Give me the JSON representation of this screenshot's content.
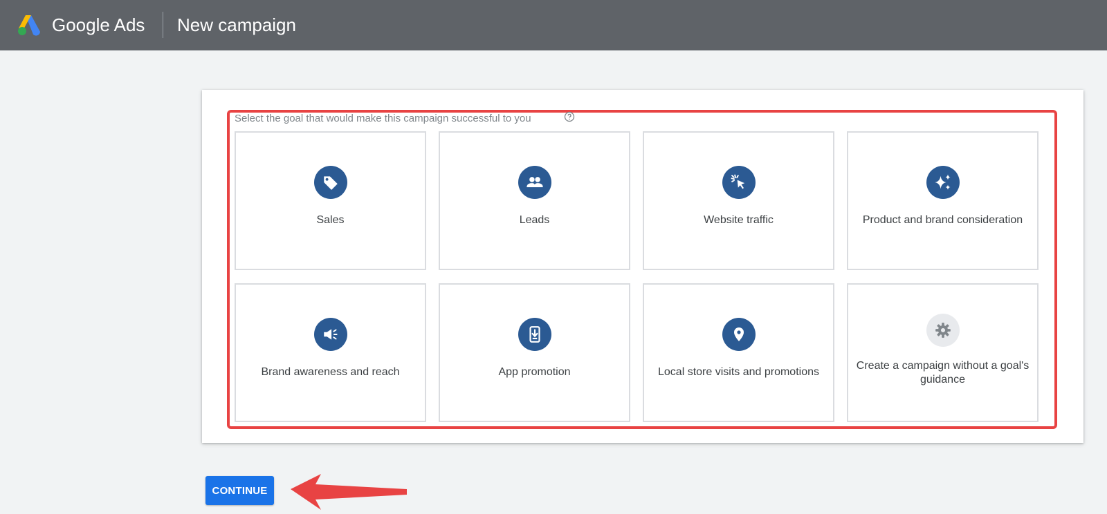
{
  "header": {
    "brand": "Google Ads",
    "page_title": "New campaign",
    "logo_icon": "google-ads-logo",
    "background_color": "#5f6368"
  },
  "goal_selection": {
    "prompt": "Select the goal that would make this campaign successful to you",
    "help_icon": "help-circle-icon",
    "goals": [
      {
        "label": "Sales",
        "icon": "tag-icon"
      },
      {
        "label": "Leads",
        "icon": "people-icon"
      },
      {
        "label": "Website traffic",
        "icon": "cursor-click-icon"
      },
      {
        "label": "Product and brand consideration",
        "icon": "sparkle-icon"
      },
      {
        "label": "Brand awareness and reach",
        "icon": "megaphone-icon"
      },
      {
        "label": "App promotion",
        "icon": "phone-download-icon"
      },
      {
        "label": "Local store visits and promotions",
        "icon": "map-pin-icon"
      },
      {
        "label": "Create a campaign without a goal's guidance",
        "icon": "gear-icon"
      }
    ],
    "icon_color": "#2b5a93",
    "highlight_color": "#e84343"
  },
  "actions": {
    "continue_label": "CONTINUE",
    "continue_color": "#1a73e8",
    "annotation_arrow_color": "#e84343"
  }
}
